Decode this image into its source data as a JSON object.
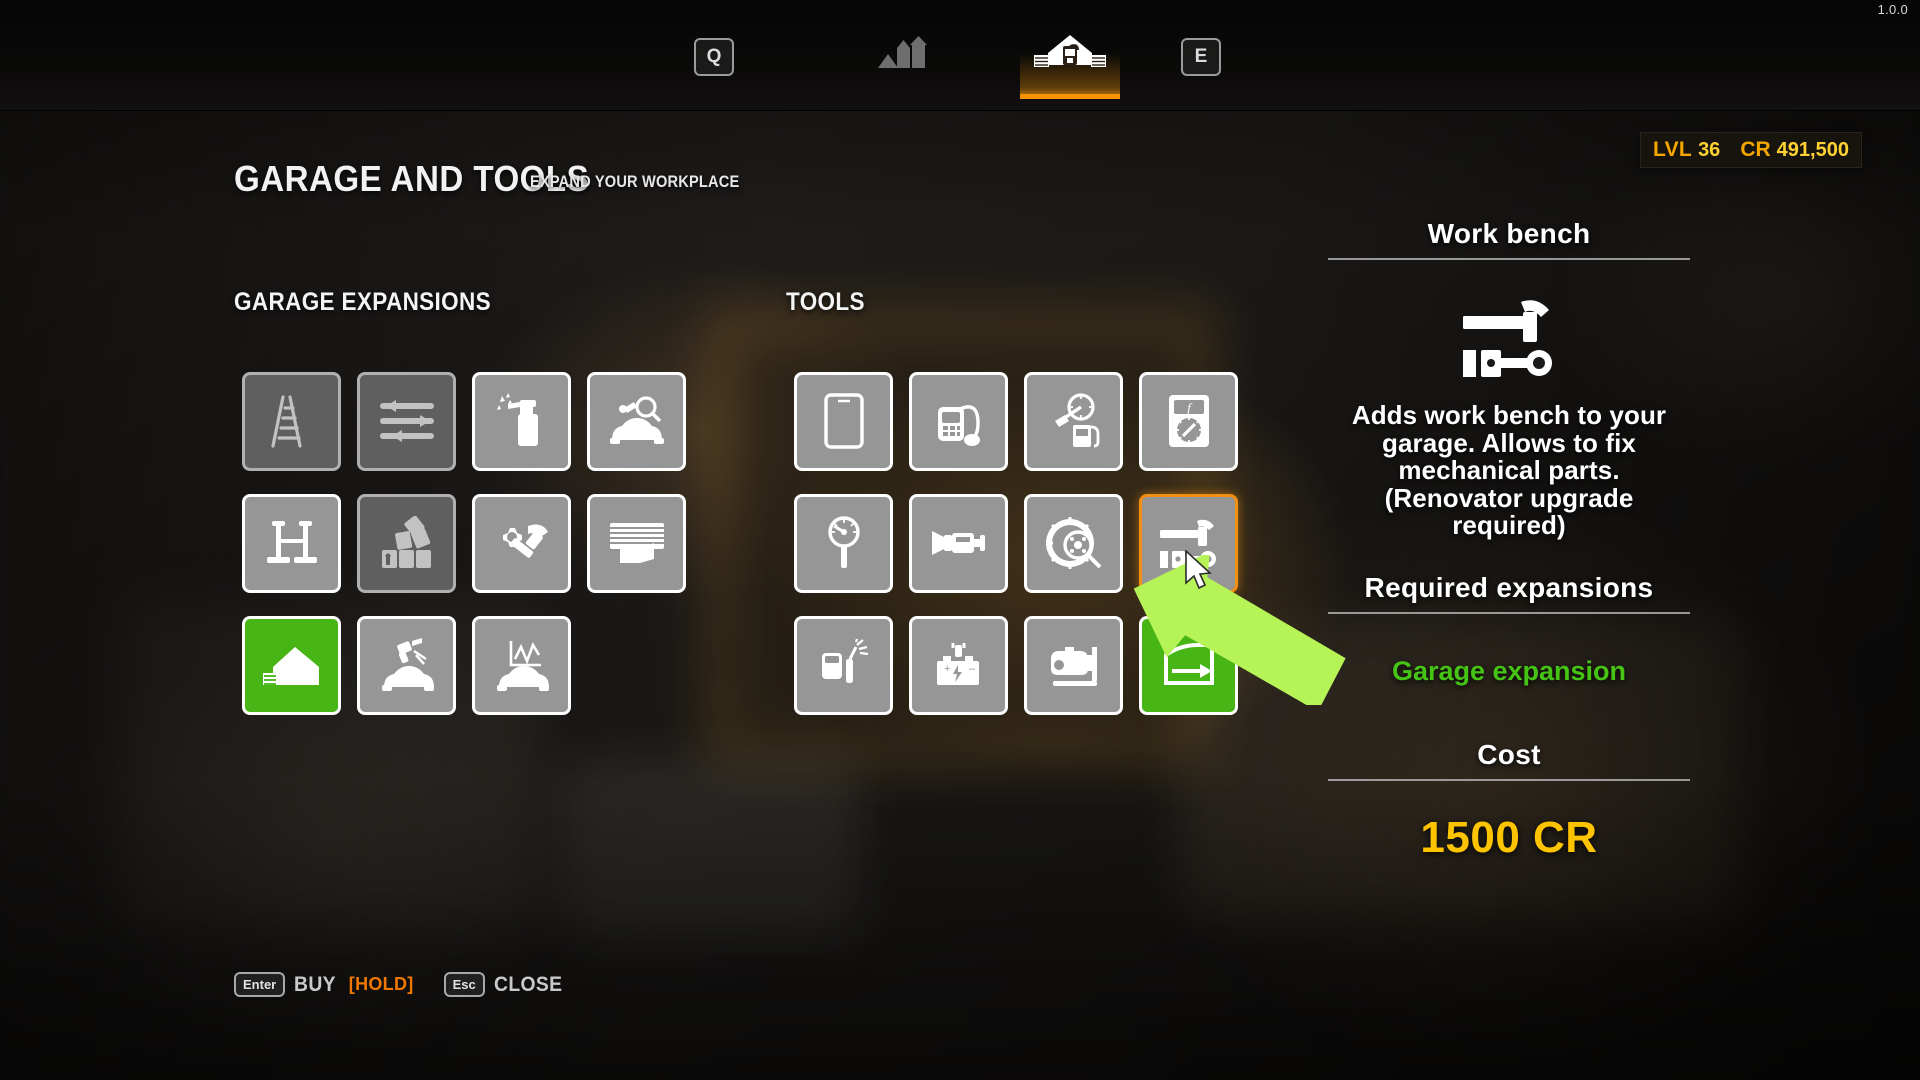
{
  "version": "1.0.0",
  "topnav": {
    "left_key": "Q",
    "right_key": "E",
    "tabs": [
      {
        "name": "skills",
        "icon": "bars-growth-icon",
        "active": false
      },
      {
        "name": "garage",
        "icon": "garage-building-icon",
        "active": true
      }
    ]
  },
  "header": {
    "title": "GARAGE AND TOOLS",
    "subtitle": "EXPAND YOUR WORKPLACE"
  },
  "status": {
    "level_label": "LVL",
    "level_value": "36",
    "credits_label": "CR",
    "credits_value": "491,500"
  },
  "sections": [
    {
      "id": "expansions",
      "title": "GARAGE EXPANSIONS"
    },
    {
      "id": "tools",
      "title": "TOOLS"
    }
  ],
  "expansions": [
    {
      "name": "ladder",
      "icon": "ladder-icon",
      "state": "locked"
    },
    {
      "name": "tuning-sliders",
      "icon": "sliders-icon",
      "state": "locked"
    },
    {
      "name": "spray-bottle",
      "icon": "spray-bottle-icon",
      "state": "available"
    },
    {
      "name": "car-inspection",
      "icon": "car-magnifier-icon",
      "state": "available"
    },
    {
      "name": "car-lift",
      "icon": "car-lift-icon",
      "state": "available"
    },
    {
      "name": "garage-build",
      "icon": "brick-stack-icon",
      "state": "locked"
    },
    {
      "name": "renovator",
      "icon": "gear-hammer-icon",
      "state": "available"
    },
    {
      "name": "garage-door",
      "icon": "garage-door-icon",
      "state": "available"
    },
    {
      "name": "garage-expansion",
      "icon": "house-garage-icon",
      "state": "owned"
    },
    {
      "name": "paint-shop",
      "icon": "spray-gun-car-icon",
      "state": "available"
    },
    {
      "name": "test-path",
      "icon": "car-chart-icon",
      "state": "available"
    }
  ],
  "tools": [
    {
      "name": "tablet",
      "icon": "tablet-icon",
      "state": "available"
    },
    {
      "name": "obd-scanner",
      "icon": "obd-scanner-icon",
      "state": "available"
    },
    {
      "name": "fuel-tester",
      "icon": "fuel-gauge-icon",
      "state": "available"
    },
    {
      "name": "multimeter",
      "icon": "multimeter-icon",
      "state": "available"
    },
    {
      "name": "compression-tester",
      "icon": "pressure-gauge-icon",
      "state": "available"
    },
    {
      "name": "cylinder-tester",
      "icon": "cylinder-tool-icon",
      "state": "available"
    },
    {
      "name": "brake-tester",
      "icon": "brake-disc-magnifier-icon",
      "state": "available"
    },
    {
      "name": "work-bench",
      "icon": "workbench-hammer-icon",
      "state": "selected"
    },
    {
      "name": "welder",
      "icon": "welder-icon",
      "state": "available"
    },
    {
      "name": "battery-charger",
      "icon": "battery-charger-icon",
      "state": "available"
    },
    {
      "name": "engine-stand",
      "icon": "engine-stand-icon",
      "state": "available"
    },
    {
      "name": "door-tool",
      "icon": "car-door-icon",
      "state": "owned"
    }
  ],
  "detail": {
    "title": "Work bench",
    "icon": "workbench-hammer-icon",
    "description": "Adds work bench to your garage. Allows to fix mechanical parts. (Renovator upgrade required)",
    "requirements_title": "Required expansions",
    "requirements_value": "Garage expansion",
    "cost_title": "Cost",
    "cost_amount": "1500",
    "cost_currency": "CR"
  },
  "actions": [
    {
      "name": "buy",
      "key": "Enter",
      "label": "BUY",
      "hold": "[HOLD]"
    },
    {
      "name": "close",
      "key": "Esc",
      "label": "CLOSE",
      "hold": ""
    }
  ],
  "colors": {
    "accent_orange": "#f18f12",
    "owned_green": "#47b516",
    "credits_yellow": "#ffc400",
    "annotation_green": "#b6f356"
  }
}
